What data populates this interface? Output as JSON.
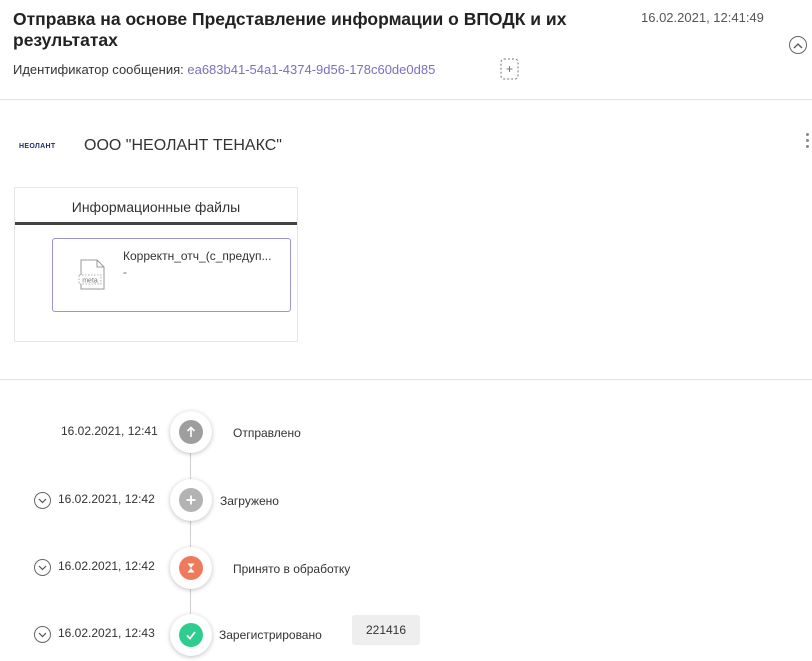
{
  "header": {
    "title": "Отправка на основе Представление информации о ВПОДК и их результатах",
    "datetime": "16.02.2021, 12:41:49",
    "message_id_label": "Идентификатор сообщения:",
    "message_id_value": "ea683b41-54a1-4374-9d56-178c60de0d85"
  },
  "organization": {
    "logo_text": "НЕОЛАНТ",
    "name": "ООО \"НЕОЛАНТ ТЕНАКС\""
  },
  "files": {
    "tab_label": "Информационные файлы",
    "items": [
      {
        "name": "Корректн_отч_(с_предуп...",
        "sub": "-",
        "icon_label": "meta"
      }
    ]
  },
  "timeline": {
    "events": [
      {
        "date": "16.02.2021, 12:41",
        "label": "Отправлено",
        "icon": "arrow-up-icon",
        "color": "#9e9e9e"
      },
      {
        "date": "16.02.2021, 12:42",
        "label": "Загружено",
        "icon": "plus-icon",
        "color": "#b3b3b3"
      },
      {
        "date": "16.02.2021, 12:42",
        "label": "Принято в обработку",
        "icon": "hourglass-icon",
        "color": "#ee7a5c"
      },
      {
        "date": "16.02.2021, 12:43",
        "label": "Зарегистрировано",
        "icon": "check-icon",
        "color": "#2ecc8f",
        "badge": "221416"
      }
    ]
  },
  "colors": {
    "accent": "#7b6fc0",
    "divider": "#e3e3e3"
  }
}
